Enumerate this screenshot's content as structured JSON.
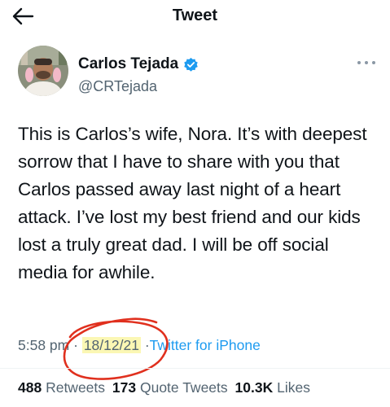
{
  "header": {
    "title": "Tweet",
    "back_icon": "arrow-left-icon"
  },
  "author": {
    "display_name": "Carlos Tejada",
    "handle": "@CRTejada",
    "verified_icon": "verified-badge-icon",
    "verified_color": "#1d9bf0"
  },
  "more_icon": "more-horizontal-icon",
  "tweet": {
    "text": "This is Carlos’s wife, Nora. It’s with deepest sorrow that I have to share with you that Carlos passed away last night of a heart attack. I’ve lost my best friend and our kids lost a truly great dad. I will be off social media for awhile."
  },
  "meta": {
    "time": "5:58 pm",
    "separator": "·",
    "date": "18/12/21",
    "source": "Twitter for iPhone"
  },
  "stats": {
    "retweets_count": "488",
    "retweets_label": "Retweets",
    "quotes_count": "173",
    "quotes_label": "Quote Tweets",
    "likes_count": "10.3K",
    "likes_label": "Likes"
  },
  "colors": {
    "link": "#1d9bf0",
    "text": "#0f1419",
    "secondary": "#536471",
    "annotation": "#e0301e",
    "highlight": "#fbf7b4"
  }
}
